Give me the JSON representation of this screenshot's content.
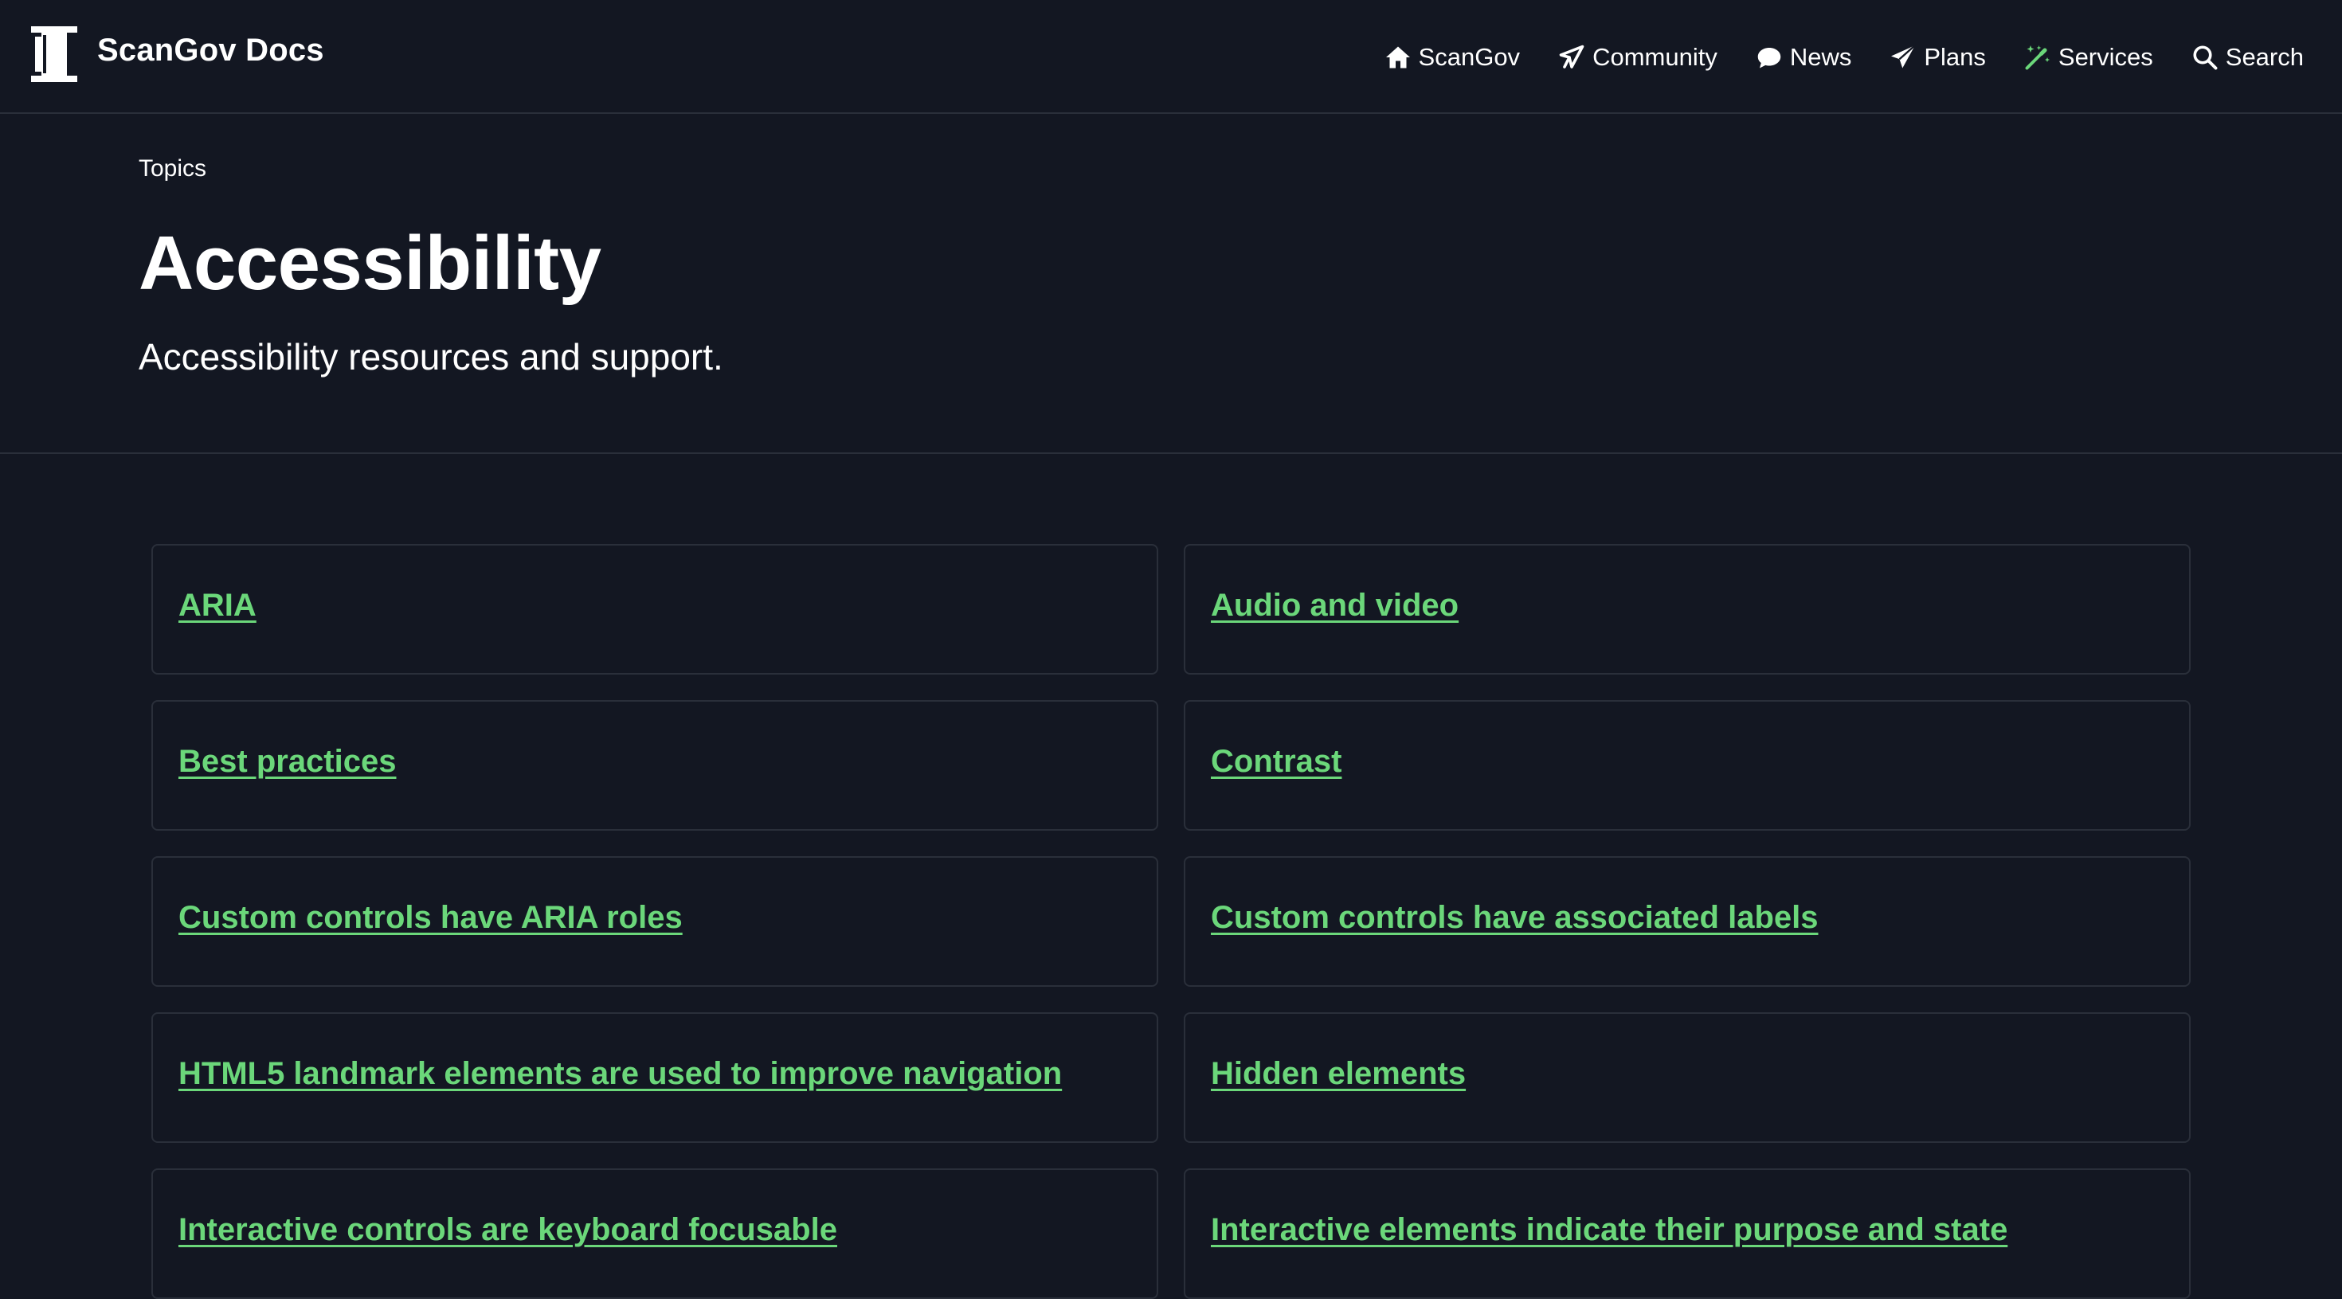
{
  "header": {
    "brand_title": "ScanGov Docs",
    "nav": [
      {
        "label": "ScanGov",
        "icon": "home-icon"
      },
      {
        "label": "Community",
        "icon": "megaphone-icon"
      },
      {
        "label": "News",
        "icon": "speech-bubble-icon"
      },
      {
        "label": "Plans",
        "icon": "paper-plane-icon"
      },
      {
        "label": "Services",
        "icon": "magic-wand-icon",
        "icon_color": "#6bd77a"
      },
      {
        "label": "Search",
        "icon": "search-icon"
      }
    ]
  },
  "hero": {
    "breadcrumb": "Topics",
    "title": "Accessibility",
    "subtitle": "Accessibility resources and support."
  },
  "topics": [
    "ARIA",
    "Audio and video",
    "Best practices",
    "Contrast",
    "Custom controls have ARIA roles",
    "Custom controls have associated labels",
    "HTML5 landmark elements are used to improve navigation",
    "Hidden elements",
    "Interactive controls are keyboard focusable",
    "Interactive elements indicate their purpose and state"
  ],
  "colors": {
    "background": "#131722",
    "border": "#2a2f3a",
    "link": "#6bd77a",
    "text": "#ffffff"
  }
}
